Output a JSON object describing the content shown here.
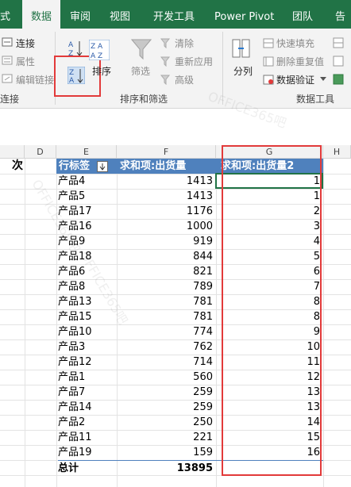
{
  "tabs": [
    {
      "label": "式",
      "active": false
    },
    {
      "label": "数据",
      "active": true
    },
    {
      "label": "审阅",
      "active": false
    },
    {
      "label": "视图",
      "active": false
    },
    {
      "label": "开发工具",
      "active": false
    },
    {
      "label": "Power Pivot",
      "active": false
    },
    {
      "label": "团队",
      "active": false
    },
    {
      "label": "告",
      "active": false
    }
  ],
  "ribbon": {
    "connections": {
      "connect": "连接",
      "properties": "属性",
      "edit_links": "编辑链接",
      "group": "连接"
    },
    "sort_filter": {
      "sort": "排序",
      "filter": "筛选",
      "clear": "清除",
      "reapply": "重新应用",
      "advanced": "高级",
      "group": "排序和筛选"
    },
    "data_tools": {
      "split": "分列",
      "flash_fill": "快速填充",
      "remove_dup": "删除重复值",
      "validation": "数据验证",
      "group": "数据工具"
    }
  },
  "columns": [
    "D",
    "E",
    "F",
    "G",
    "H"
  ],
  "left_header_fragment": "次",
  "pivot": {
    "headers": [
      "行标签",
      "求和项:出货量",
      "求和项:出货量2"
    ],
    "rows": [
      {
        "label": "产品4",
        "qty": 1413,
        "rank": 1
      },
      {
        "label": "产品5",
        "qty": 1413,
        "rank": 1
      },
      {
        "label": "产品17",
        "qty": 1176,
        "rank": 2
      },
      {
        "label": "产品16",
        "qty": 1000,
        "rank": 3
      },
      {
        "label": "产品9",
        "qty": 919,
        "rank": 4
      },
      {
        "label": "产品18",
        "qty": 844,
        "rank": 5
      },
      {
        "label": "产品6",
        "qty": 821,
        "rank": 6
      },
      {
        "label": "产品8",
        "qty": 789,
        "rank": 7
      },
      {
        "label": "产品13",
        "qty": 781,
        "rank": 8
      },
      {
        "label": "产品15",
        "qty": 781,
        "rank": 8
      },
      {
        "label": "产品10",
        "qty": 774,
        "rank": 9
      },
      {
        "label": "产品3",
        "qty": 762,
        "rank": 10
      },
      {
        "label": "产品12",
        "qty": 714,
        "rank": 11
      },
      {
        "label": "产品1",
        "qty": 560,
        "rank": 12
      },
      {
        "label": "产品7",
        "qty": 259,
        "rank": 13
      },
      {
        "label": "产品14",
        "qty": 259,
        "rank": 13
      },
      {
        "label": "产品2",
        "qty": 250,
        "rank": 14
      },
      {
        "label": "产品11",
        "qty": 221,
        "rank": 15
      },
      {
        "label": "产品19",
        "qty": 159,
        "rank": 16
      }
    ],
    "total_label": "总计",
    "total_qty": 13895
  },
  "watermark": "OFFICE365吧",
  "colors": {
    "excel_green": "#217346",
    "pivot_header": "#4f81bd",
    "highlight": "#e23a3a"
  }
}
